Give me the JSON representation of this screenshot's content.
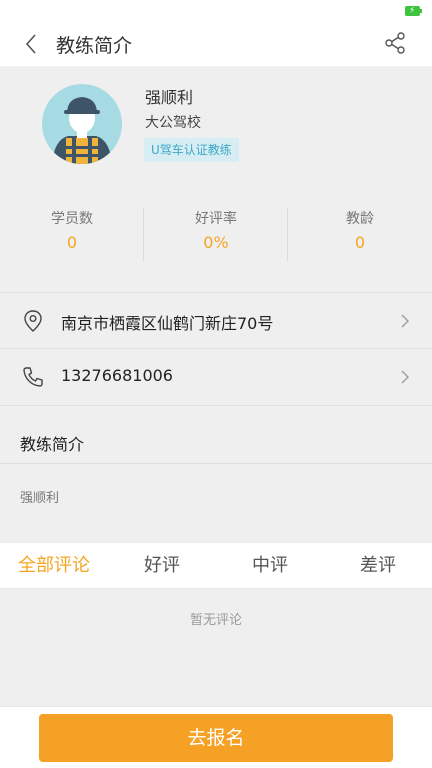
{
  "header": {
    "title": "教练简介",
    "back_icon": "chevron-left-icon",
    "share_icon": "share-icon"
  },
  "coach": {
    "name": "强顺利",
    "school": "大公驾校",
    "badge": "U驾车认证教练"
  },
  "stats": [
    {
      "label": "学员数",
      "value": "0"
    },
    {
      "label": "好评率",
      "value": "0%"
    },
    {
      "label": "教龄",
      "value": "0"
    }
  ],
  "contact": {
    "address": "南京市栖霞区仙鹤门新庄70号",
    "phone": "13276681006"
  },
  "intro": {
    "title": "教练简介",
    "body": "强顺利"
  },
  "review_tabs": [
    {
      "label": "全部评论",
      "active": true
    },
    {
      "label": "好评",
      "active": false
    },
    {
      "label": "中评",
      "active": false
    },
    {
      "label": "差评",
      "active": false
    }
  ],
  "reviews": {
    "empty_text": "暂无评论"
  },
  "footer": {
    "signup_label": "去报名"
  },
  "colors": {
    "accent": "#f5a524",
    "badge_bg": "#d6eef3",
    "badge_text": "#3fa7c8",
    "avatar_bg": "#a6dbe4"
  }
}
